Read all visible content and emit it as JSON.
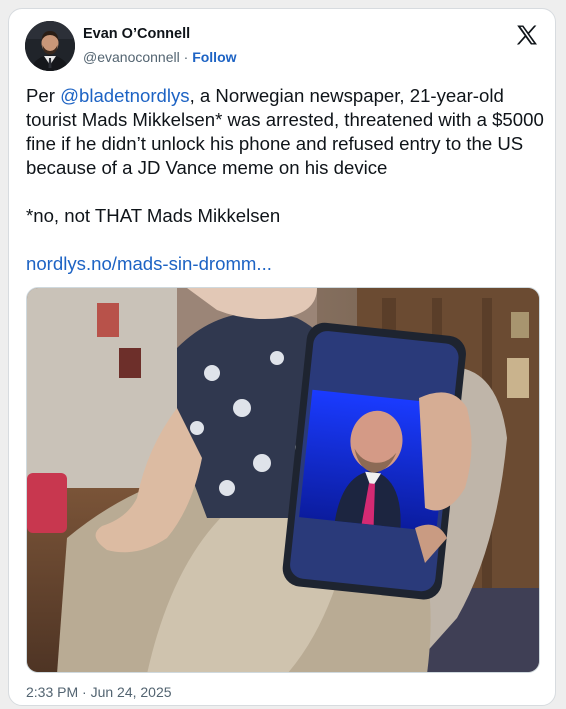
{
  "author": {
    "name": "Evan O’Connell",
    "handle": "@evanoconnell",
    "separator": "·",
    "follow_label": "Follow",
    "avatar_icon": "profile-photo"
  },
  "platform_icon": "x-logo-icon",
  "tweet": {
    "intro": "Per ",
    "mention": "@bladetnordlys",
    "body": ", a Norwegian newspaper, 21-year-old tourist Mads Mikkelsen* was arrested, threatened with a $5000 fine if he didn’t unlock his phone and refused entry to the US because of a JD Vance meme on his device",
    "note": "*no, not THAT Mads Mikkelsen",
    "link_text": "nordlys.no/mads-sin-dromm..."
  },
  "media": {
    "description_icon": "photo-person-holding-phone"
  },
  "meta": {
    "timestamp": "2:33 PM · Jun 24, 2025"
  },
  "colors": {
    "link": "#1d63c4",
    "text": "#0f1419",
    "muted": "#536471"
  }
}
